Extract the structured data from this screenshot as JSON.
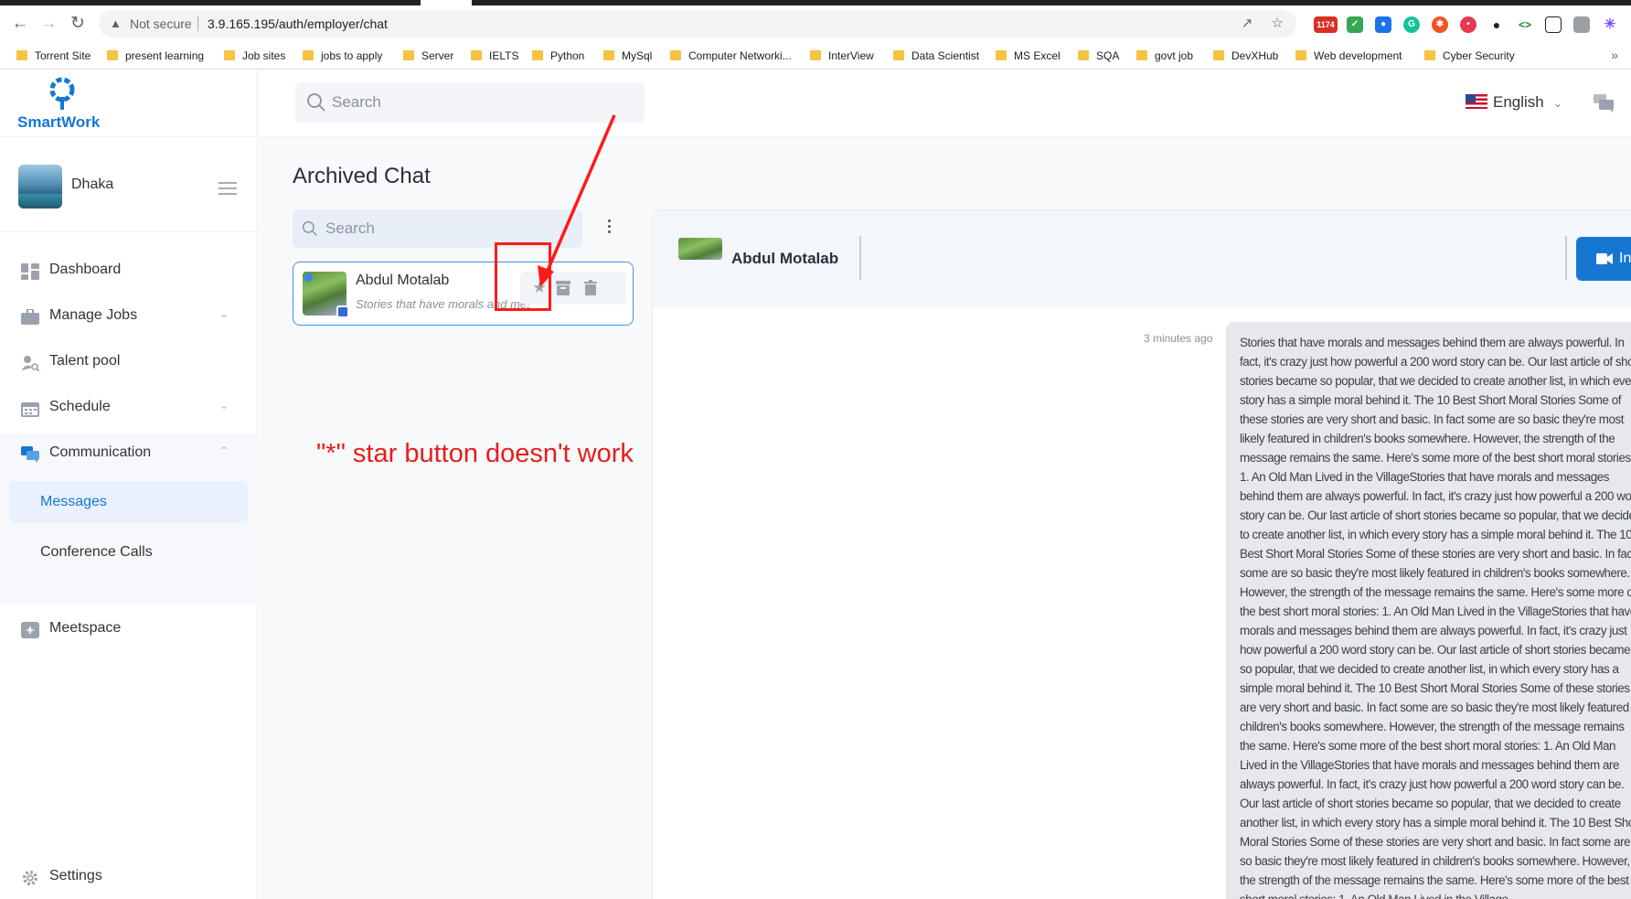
{
  "browser": {
    "security_label": "Not secure",
    "url": "3.9.165.195/auth/employer/chat",
    "bookmarks": [
      "Torrent Site",
      "present learning",
      "Job sites",
      "jobs to apply",
      "Server",
      "IELTS",
      "Python",
      "MySql",
      "Computer Networki...",
      "InterView",
      "Data Scientist",
      "MS Excel",
      "SQA",
      "govt job",
      "DevXHub",
      "Web development",
      "Cyber Security"
    ],
    "more_label": "»",
    "badge_count": "1174"
  },
  "sidebar": {
    "brand": "SmartWork",
    "profile_name": "Dhaka",
    "items": [
      {
        "label": "Dashboard",
        "icon": "dashboard-icon"
      },
      {
        "label": "Manage Jobs",
        "icon": "briefcase-icon"
      },
      {
        "label": "Talent pool",
        "icon": "user-search-icon"
      },
      {
        "label": "Schedule",
        "icon": "calendar-icon"
      },
      {
        "label": "Communication",
        "icon": "chat-bubbles-icon"
      }
    ],
    "sub_items": [
      "Messages",
      "Conference Calls"
    ],
    "meetspace": "Meetspace",
    "settings": "Settings"
  },
  "header": {
    "search_placeholder": "Search",
    "language": "English"
  },
  "page": {
    "title": "Archived Chat",
    "list_search_placeholder": "Search"
  },
  "chat_list": [
    {
      "name": "Abdul Motalab",
      "preview": "Stories that have morals and messages behind them are always powerful."
    }
  ],
  "annotation": {
    "text": "\"*\" star button doesn't work",
    "color": "#e81c1c"
  },
  "conversation": {
    "name": "Abdul Motalab",
    "call_button": "In",
    "timestamp": "3 minutes ago",
    "message": "Stories that have morals and messages behind them are always powerful. In fact, it's crazy just how powerful a 200 word story can be. Our last article of short stories became so popular, that we decided to create another list, in which every story has a simple moral behind it. The 10 Best Short Moral Stories Some of these stories are very short and basic. In fact some are so basic they're most likely featured in children's books somewhere. However, the strength of the message remains the same. Here's some more of the best short moral stories: 1. An Old Man Lived in the VillageStories that have morals and messages behind them are always powerful. In fact, it's crazy just how powerful a 200 word story can be. Our last article of short stories became so popular, that we decided to create another list, in which every story has a simple moral behind it. The 10 Best Short Moral Stories Some of these stories are very short and basic. In fact some are so basic they're most likely featured in children's books somewhere. However, the strength of the message remains the same. Here's some more of the best short moral stories: 1. An Old Man Lived in the VillageStories that have morals and messages behind them are always powerful. In fact, it's crazy just how powerful a 200 word story can be. Our last article of short stories became so popular, that we decided to create another list, in which every story has a simple moral behind it. The 10 Best Short Moral Stories Some of these stories are very short and basic. In fact some are so basic they're most likely featured in children's books somewhere. However, the strength of the message remains the same. Here's some more of the best short moral stories: 1. An Old Man Lived in the VillageStories that have morals and messages behind them are always powerful. In fact, it's crazy just how powerful a 200 word story can be. Our last article of short stories became so popular, that we decided to create another list, in which every story has a simple moral behind it. The 10 Best Short Moral Stories Some of these stories are very short and basic. In fact some are so basic they're most likely featured in children's books somewhere. However, the strength of the message remains the same. Here's some more of the best short moral stories: 1. An Old Man Lived in the Village"
  },
  "colors": {
    "accent": "#1677d2",
    "annotation_red": "#ff1a1a"
  }
}
